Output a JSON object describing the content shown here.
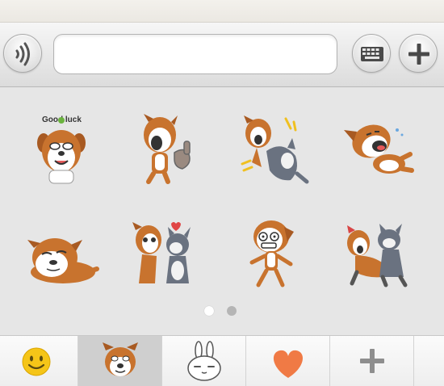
{
  "input_bar": {
    "voice_icon": "voice-wave-icon",
    "message_value": "",
    "keyboard_icon": "keyboard-icon",
    "plus_icon": "plus-icon"
  },
  "sticker_panel": {
    "stickers": [
      {
        "name": "good-luck-dog",
        "caption": "Good luck"
      },
      {
        "name": "thumbs-up-dog",
        "caption": ""
      },
      {
        "name": "cat-fight-dog",
        "caption": ""
      },
      {
        "name": "laughing-rolling-dog",
        "caption": ""
      },
      {
        "name": "lying-sleepy-dog",
        "caption": ""
      },
      {
        "name": "kissing-cat-dog",
        "caption": ""
      },
      {
        "name": "dancing-dog",
        "caption": ""
      },
      {
        "name": "dog-and-cat-hug",
        "caption": ""
      }
    ],
    "page_count": 2,
    "current_page": 1
  },
  "tab_bar": {
    "tabs": [
      {
        "icon": "smiley-icon",
        "selected": false
      },
      {
        "icon": "dog-face-icon",
        "selected": true
      },
      {
        "icon": "bunny-icon",
        "selected": false
      },
      {
        "icon": "heart-icon",
        "selected": false
      },
      {
        "icon": "add-sticker-plus-icon",
        "selected": false
      }
    ]
  },
  "colors": {
    "dog_brown": "#c8732e",
    "cat_gray": "#6a7280",
    "heart_orange": "#f07a45",
    "smiley_yellow": "#f5c518"
  }
}
